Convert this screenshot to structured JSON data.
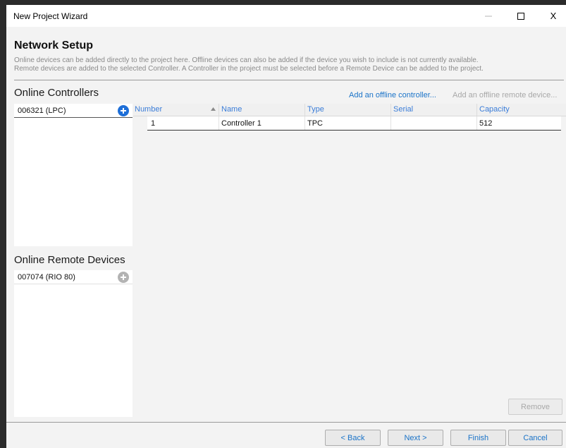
{
  "window": {
    "title": "New Project Wizard",
    "controls": {
      "minimize_icon": "minimize-icon",
      "maximize_icon": "maximize-icon",
      "close_label": "X"
    }
  },
  "header": {
    "heading": "Network Setup",
    "description_line1": "Online devices can be added directly to the project here. Offline devices can also be added if the device you wish to include is not currently available.",
    "description_line2": "Remote devices are added to the selected Controller. A Controller in the project must be selected before a Remote Device can be added to the project."
  },
  "controllers": {
    "title": "Online Controllers",
    "items": [
      {
        "label": "006321 (LPC)",
        "icon": "add-circle-icon",
        "enabled": true
      }
    ]
  },
  "remote_devices": {
    "title": "Online Remote Devices",
    "items": [
      {
        "label": "007074 (RIO 80)",
        "icon": "add-circle-icon",
        "enabled": false
      }
    ]
  },
  "actions": {
    "add_offline_controller": "Add an offline controller...",
    "add_offline_remote_device": "Add an offline remote device..."
  },
  "table": {
    "columns": [
      "Number",
      "Name",
      "Type",
      "Serial",
      "Capacity"
    ],
    "sorted_column": "Name",
    "sort_direction": "ascending",
    "rows": [
      {
        "number": "1",
        "name": "Controller 1",
        "type": "TPC",
        "serial": "",
        "capacity": "512"
      }
    ]
  },
  "buttons": {
    "remove": "Remove",
    "back": "< Back",
    "next": "Next >",
    "finish": "Finish",
    "cancel": "Cancel"
  },
  "colors": {
    "accent": "#1a73c8",
    "add_icon_enabled": "#1e6fd8",
    "add_icon_disabled": "#b3b3b3",
    "background": "#f3f3f3"
  }
}
